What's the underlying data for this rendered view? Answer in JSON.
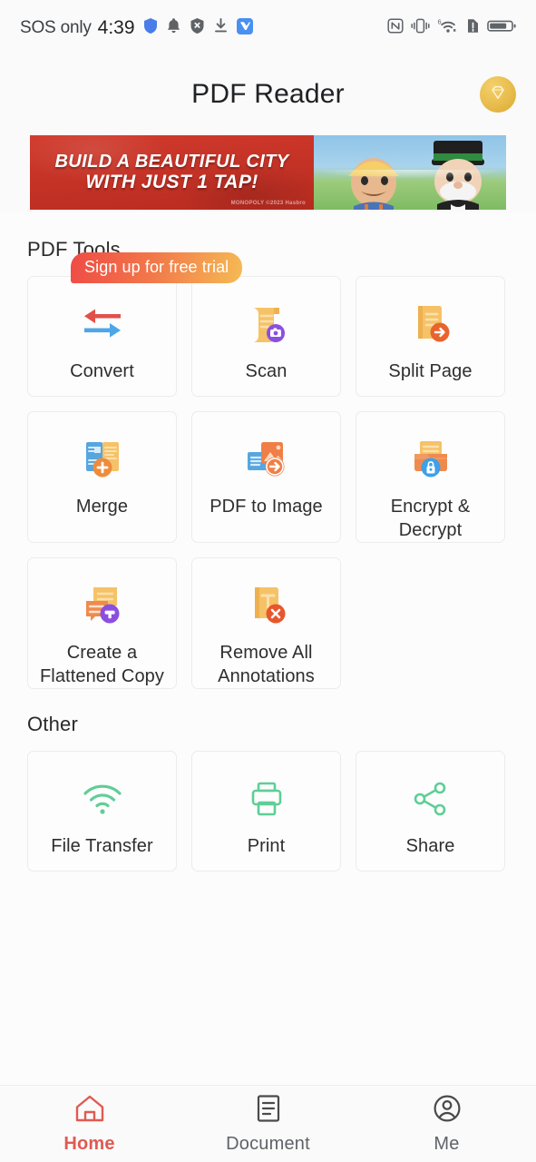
{
  "status_bar": {
    "carrier": "SOS only",
    "time": "4:39",
    "left_icons": [
      "shield-icon",
      "bell-icon",
      "shield-x-icon",
      "download-icon",
      "app-badge-icon"
    ],
    "right_icons": [
      "nfc-icon",
      "vibrate-icon",
      "wifi-6-icon",
      "sim-alert-icon",
      "battery-icon"
    ]
  },
  "header": {
    "title": "PDF Reader",
    "vip_icon": "diamond-icon",
    "vip_color": "#e8bc4c"
  },
  "ad_banner": {
    "line1": "BUILD A BEAUTIFUL CITY",
    "line2": "WITH JUST 1 TAP!",
    "legal": "MONOPOLY ©2023 Hasbro",
    "bg_color": "#c0392b"
  },
  "pdf_tools": {
    "title": "PDF Tools",
    "trial_badge": "Sign up for free trial",
    "items": [
      {
        "label": "Convert",
        "icon": "convert-arrows-icon"
      },
      {
        "label": "Scan",
        "icon": "scan-camera-icon"
      },
      {
        "label": "Split Page",
        "icon": "split-page-icon"
      },
      {
        "label": "Merge",
        "icon": "merge-plus-icon"
      },
      {
        "label": "PDF to Image",
        "icon": "pdf-to-image-icon"
      },
      {
        "label": "Encrypt & Decrypt",
        "icon": "encrypt-lock-icon"
      },
      {
        "label": "Create a Flattened Copy",
        "icon": "flatten-copy-icon"
      },
      {
        "label": "Remove All Annotations",
        "icon": "remove-annotations-icon"
      }
    ]
  },
  "other": {
    "title": "Other",
    "accent_color": "#5fce96",
    "items": [
      {
        "label": "File Transfer",
        "icon": "wifi-icon"
      },
      {
        "label": "Print",
        "icon": "printer-icon"
      },
      {
        "label": "Share",
        "icon": "share-nodes-icon"
      }
    ]
  },
  "bottom_nav": {
    "active_color": "#e05a52",
    "inactive_color": "#5f6368",
    "items": [
      {
        "label": "Home",
        "icon": "home-icon",
        "active": true
      },
      {
        "label": "Document",
        "icon": "document-icon",
        "active": false
      },
      {
        "label": "Me",
        "icon": "person-icon",
        "active": false
      }
    ]
  }
}
